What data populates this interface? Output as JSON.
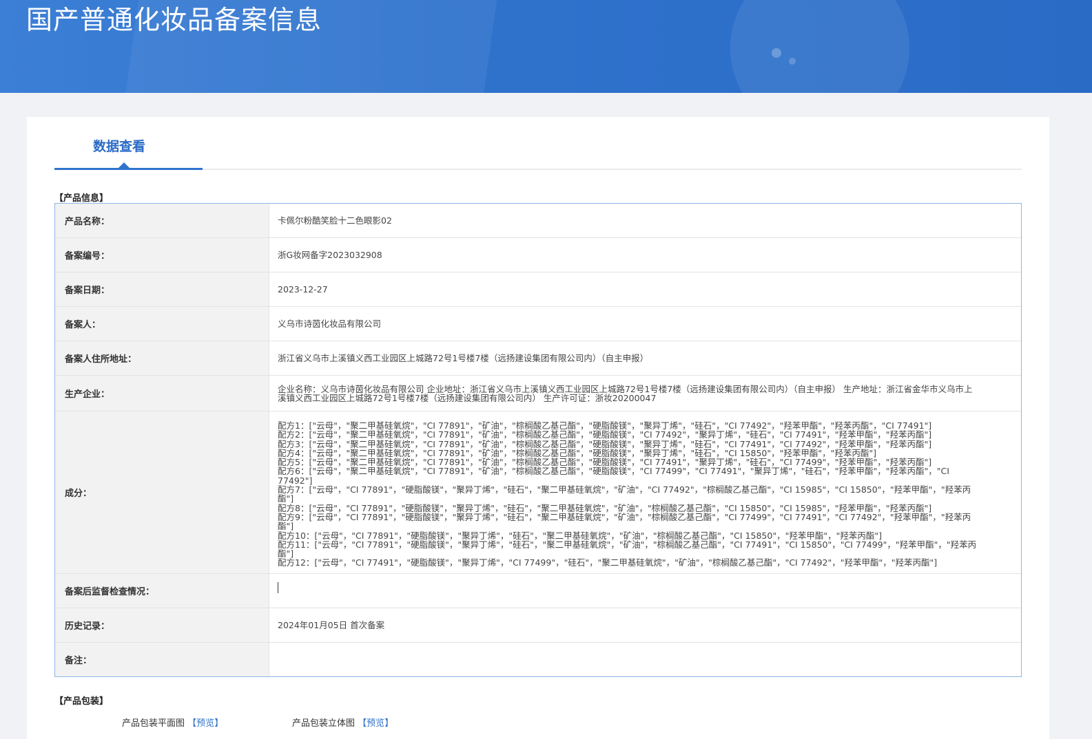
{
  "header": {
    "title": "国产普通化妆品备案信息"
  },
  "tabs": {
    "active_label": "数据查看"
  },
  "product_info": {
    "section_title": "【产品信息】",
    "rows": [
      {
        "label": "产品名称：",
        "value": "卡佩尔粉酷笑脸十二色眼影02"
      },
      {
        "label": "备案编号：",
        "value": "浙G妆网备字2023032908"
      },
      {
        "label": "备案日期：",
        "value": "2023-12-27"
      },
      {
        "label": "备案人：",
        "value": "义乌市诗茵化妆品有限公司"
      },
      {
        "label": "备案人住所地址：",
        "value": "浙江省义乌市上溪镇义西工业园区上城路72号1号楼7楼（远扬建设集团有限公司内）（自主申报）"
      },
      {
        "label": "生产企业：",
        "value": "企业名称：义乌市诗茵化妆品有限公司 企业地址：浙江省义乌市上溪镇义西工业园区上城路72号1号楼7楼（远扬建设集团有限公司内）（自主申报） 生产地址：浙江省金华市义乌市上溪镇义西工业园区上城路72号1号楼7楼（远扬建设集团有限公司内） 生产许可证：浙妆20200047"
      },
      {
        "label": "成分：",
        "lines": [
          "配方1：[\"云母\"，\"聚二甲基硅氧烷\"，\"CI 77891\"，\"矿油\"，\"棕榈酸乙基己酯\"，\"硬脂酸镁\"，\"聚异丁烯\"，\"硅石\"，\"CI 77492\"，\"羟苯甲酯\"，\"羟苯丙酯\"，\"CI 77491\"]",
          "配方2：[\"云母\"，\"聚二甲基硅氧烷\"，\"CI 77891\"，\"矿油\"，\"棕榈酸乙基己酯\"，\"硬脂酸镁\"，\"CI 77492\"，\"聚异丁烯\"，\"硅石\"，\"CI 77491\"，\"羟苯甲酯\"，\"羟苯丙酯\"]",
          "配方3：[\"云母\"，\"聚二甲基硅氧烷\"，\"CI 77891\"，\"矿油\"，\"棕榈酸乙基己酯\"，\"硬脂酸镁\"，\"聚异丁烯\"，\"硅石\"，\"CI 77491\"，\"CI 77492\"，\"羟苯甲酯\"，\"羟苯丙酯\"]",
          "配方4：[\"云母\"，\"聚二甲基硅氧烷\"，\"CI 77891\"，\"矿油\"，\"棕榈酸乙基己酯\"，\"硬脂酸镁\"，\"聚异丁烯\"，\"硅石\"，\"CI 15850\"，\"羟苯甲酯\"，\"羟苯丙酯\"]",
          "配方5：[\"云母\"，\"聚二甲基硅氧烷\"，\"CI 77891\"，\"矿油\"，\"棕榈酸乙基己酯\"，\"硬脂酸镁\"，\"CI 77491\"，\"聚异丁烯\"，\"硅石\"，\"CI 77499\"，\"羟苯甲酯\"，\"羟苯丙酯\"]",
          "配方6：[\"云母\"，\"聚二甲基硅氧烷\"，\"CI 77891\"，\"矿油\"，\"棕榈酸乙基己酯\"，\"硬脂酸镁\"，\"CI 77499\"，\"CI 77491\"，\"聚异丁烯\"，\"硅石\"，\"羟苯甲酯\"，\"羟苯丙酯\"，\"CI 77492\"]",
          "配方7：[\"云母\"，\"CI 77891\"，\"硬脂酸镁\"，\"聚异丁烯\"，\"硅石\"，\"聚二甲基硅氧烷\"，\"矿油\"，\"CI 77492\"，\"棕榈酸乙基己酯\"，\"CI 15985\"，\"CI 15850\"，\"羟苯甲酯\"，\"羟苯丙酯\"]",
          "配方8：[\"云母\"，\"CI 77891\"，\"硬脂酸镁\"，\"聚异丁烯\"，\"硅石\"，\"聚二甲基硅氧烷\"，\"矿油\"，\"棕榈酸乙基己酯\"，\"CI 15850\"，\"CI 15985\"，\"羟苯甲酯\"，\"羟苯丙酯\"]",
          "配方9：[\"云母\"，\"CI 77891\"，\"硬脂酸镁\"，\"聚异丁烯\"，\"硅石\"，\"聚二甲基硅氧烷\"，\"矿油\"，\"棕榈酸乙基己酯\"，\"CI 77499\"，\"CI 77491\"，\"CI 77492\"，\"羟苯甲酯\"，\"羟苯丙酯\"]",
          "配方10：[\"云母\"，\"CI 77891\"，\"硬脂酸镁\"，\"聚异丁烯\"，\"硅石\"，\"聚二甲基硅氧烷\"，\"矿油\"，\"棕榈酸乙基己酯\"，\"CI 15850\"，\"羟苯甲酯\"，\"羟苯丙酯\"]",
          "配方11：[\"云母\"，\"CI 77891\"，\"硬脂酸镁\"，\"聚异丁烯\"，\"硅石\"，\"聚二甲基硅氧烷\"，\"矿油\"，\"棕榈酸乙基己酯\"，\"CI 77491\"，\"CI 15850\"，\"CI 77499\"，\"羟苯甲酯\"，\"羟苯丙酯\"]",
          "配方12：[\"云母\"，\"CI 77491\"，\"硬脂酸镁\"，\"聚异丁烯\"，\"CI 77499\"，\"硅石\"，\"聚二甲基硅氧烷\"，\"矿油\"，\"棕榈酸乙基己酯\"，\"CI 77492\"，\"羟苯甲酯\"，\"羟苯丙酯\"]"
        ]
      },
      {
        "label": "备案后监督检查情况：",
        "value": ""
      },
      {
        "label": "历史记录：",
        "value": "2024年01月05日 首次备案"
      },
      {
        "label": "备注：",
        "value": ""
      }
    ]
  },
  "packaging": {
    "section_title": "【产品包装】",
    "flat_label": "产品包装平面图",
    "stereo_label": "产品包装立体图",
    "preview_text": "预览"
  }
}
